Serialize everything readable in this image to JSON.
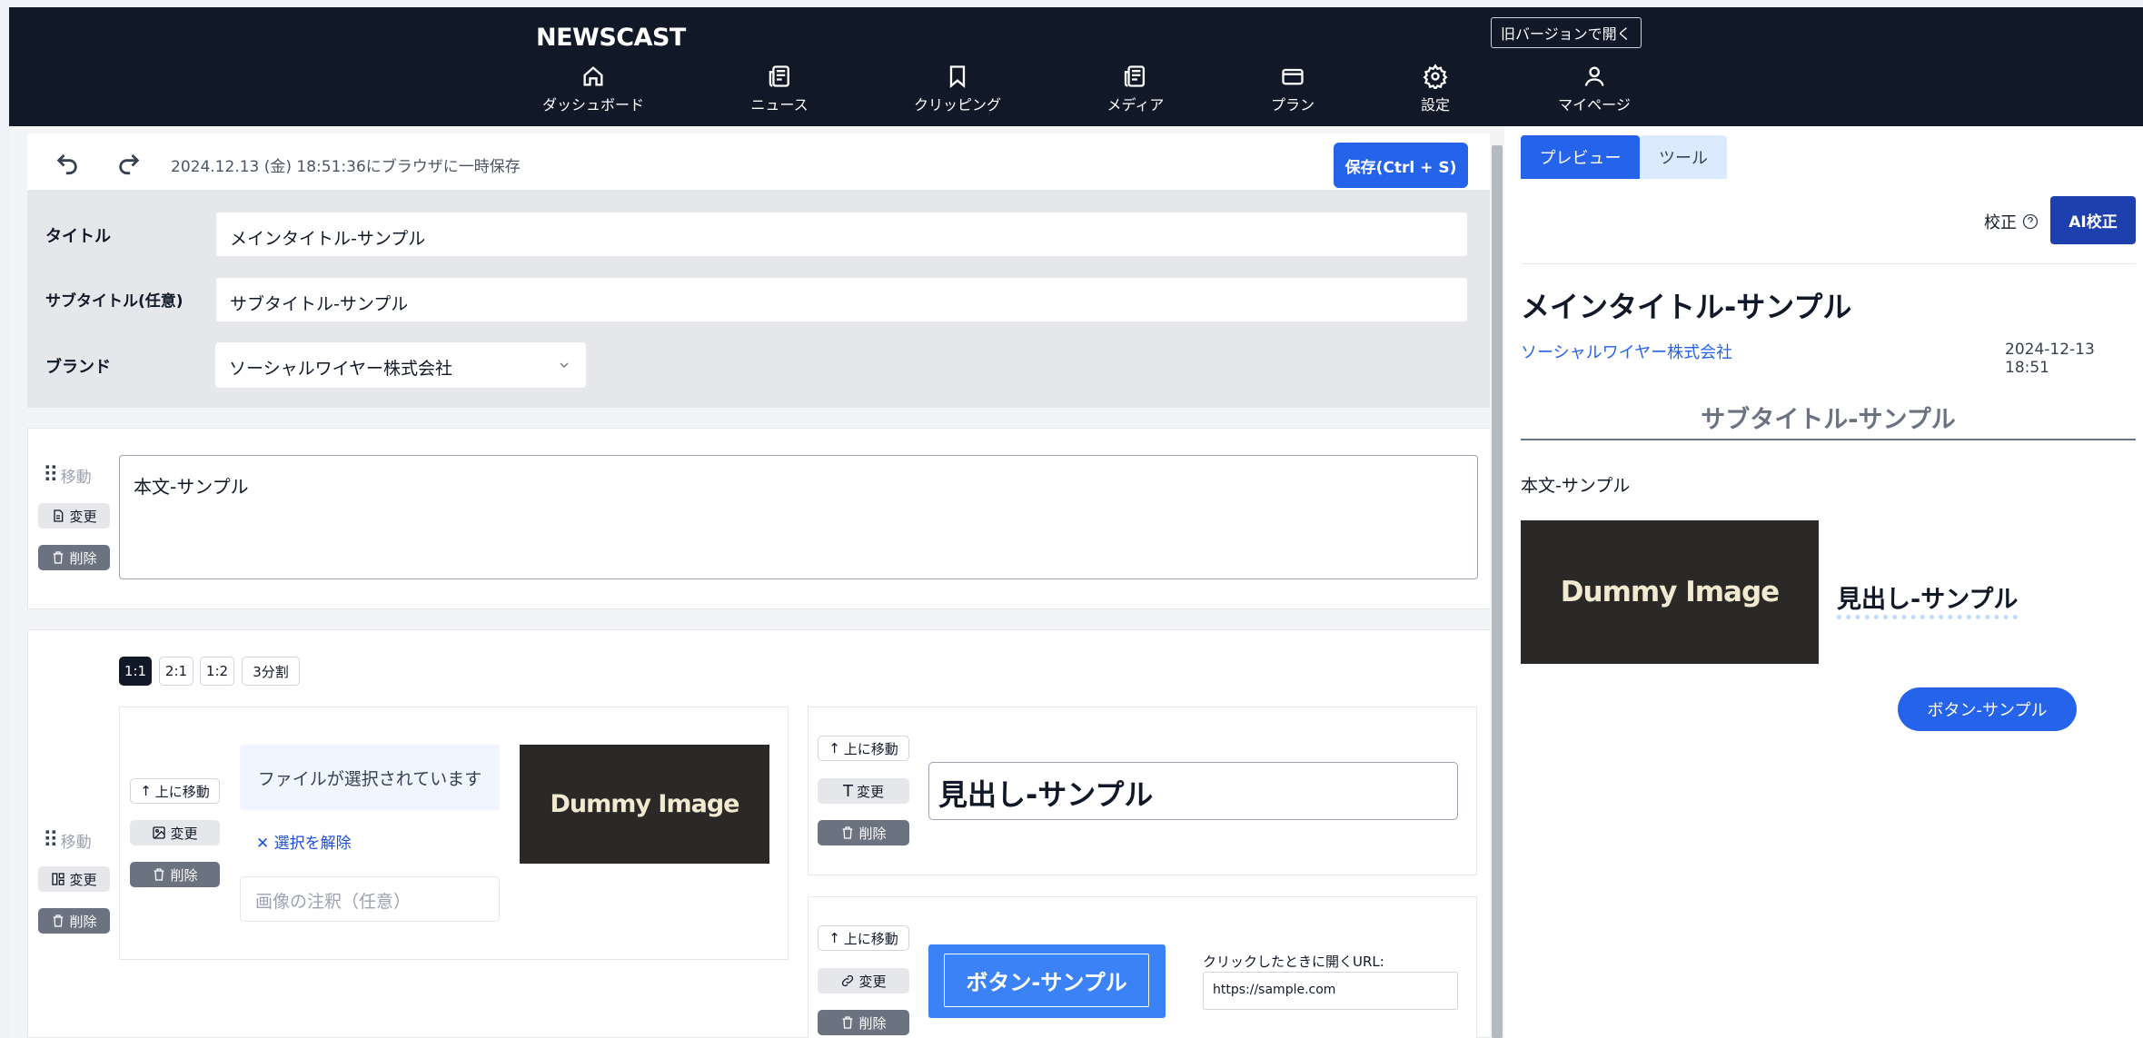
{
  "header": {
    "brand": "NEWSCAST",
    "old_version": "旧バージョンで開く",
    "nav": [
      {
        "label": "ダッシュボード",
        "icon": "home-icon"
      },
      {
        "label": "ニュース",
        "icon": "newspaper-icon"
      },
      {
        "label": "クリッピング",
        "icon": "bookmark-icon"
      },
      {
        "label": "メディア",
        "icon": "newspaper-icon"
      },
      {
        "label": "プラン",
        "icon": "credit-card-icon"
      },
      {
        "label": "設定",
        "icon": "gear-icon"
      },
      {
        "label": "マイページ",
        "icon": "user-icon"
      }
    ]
  },
  "toolbar": {
    "autosave": "2024.12.13 (金) 18:51:36にブラウザに一時保存",
    "save": "保存(Ctrl + S)"
  },
  "meta": {
    "title_label": "タイトル",
    "title_value": "メインタイトル-サンプル",
    "subtitle_label": "サブタイトル(任意)",
    "subtitle_value": "サブタイトル-サンプル",
    "brand_label": "ブランド",
    "brand_value": "ソーシャルワイヤー株式会社"
  },
  "block_controls": {
    "move": "移動",
    "change": "変更",
    "delete": "削除",
    "move_up": "上に移動"
  },
  "text_block": {
    "value": "本文-サンプル"
  },
  "ratios": [
    "1:1",
    "2:1",
    "1:2",
    "3分割"
  ],
  "image_block": {
    "file_status": "ファイルが選択されています",
    "deselect": "選択を解除",
    "caption_placeholder": "画像の注釈（任意）",
    "dummy": "Dummy Image"
  },
  "heading_block": {
    "value": "見出し-サンプル"
  },
  "button_block": {
    "label": "ボタン-サンプル",
    "url_label": "クリックしたときに開くURL:",
    "url_value": "https://sample.com"
  },
  "preview": {
    "tab_preview": "プレビュー",
    "tab_tools": "ツール",
    "proof": "校正",
    "ai_proof": "AI校正",
    "title": "メインタイトル-サンプル",
    "company": "ソーシャルワイヤー株式会社",
    "date": "2024-12-13 18:51",
    "subtitle": "サブタイトル-サンプル",
    "body": "本文-サンプル",
    "dummy": "Dummy Image",
    "heading": "見出し-サンプル",
    "button": "ボタン-サンプル"
  },
  "colors": {
    "header_bg": "#111827",
    "accent": "#2563eb",
    "accent_dark": "#1e40af"
  }
}
